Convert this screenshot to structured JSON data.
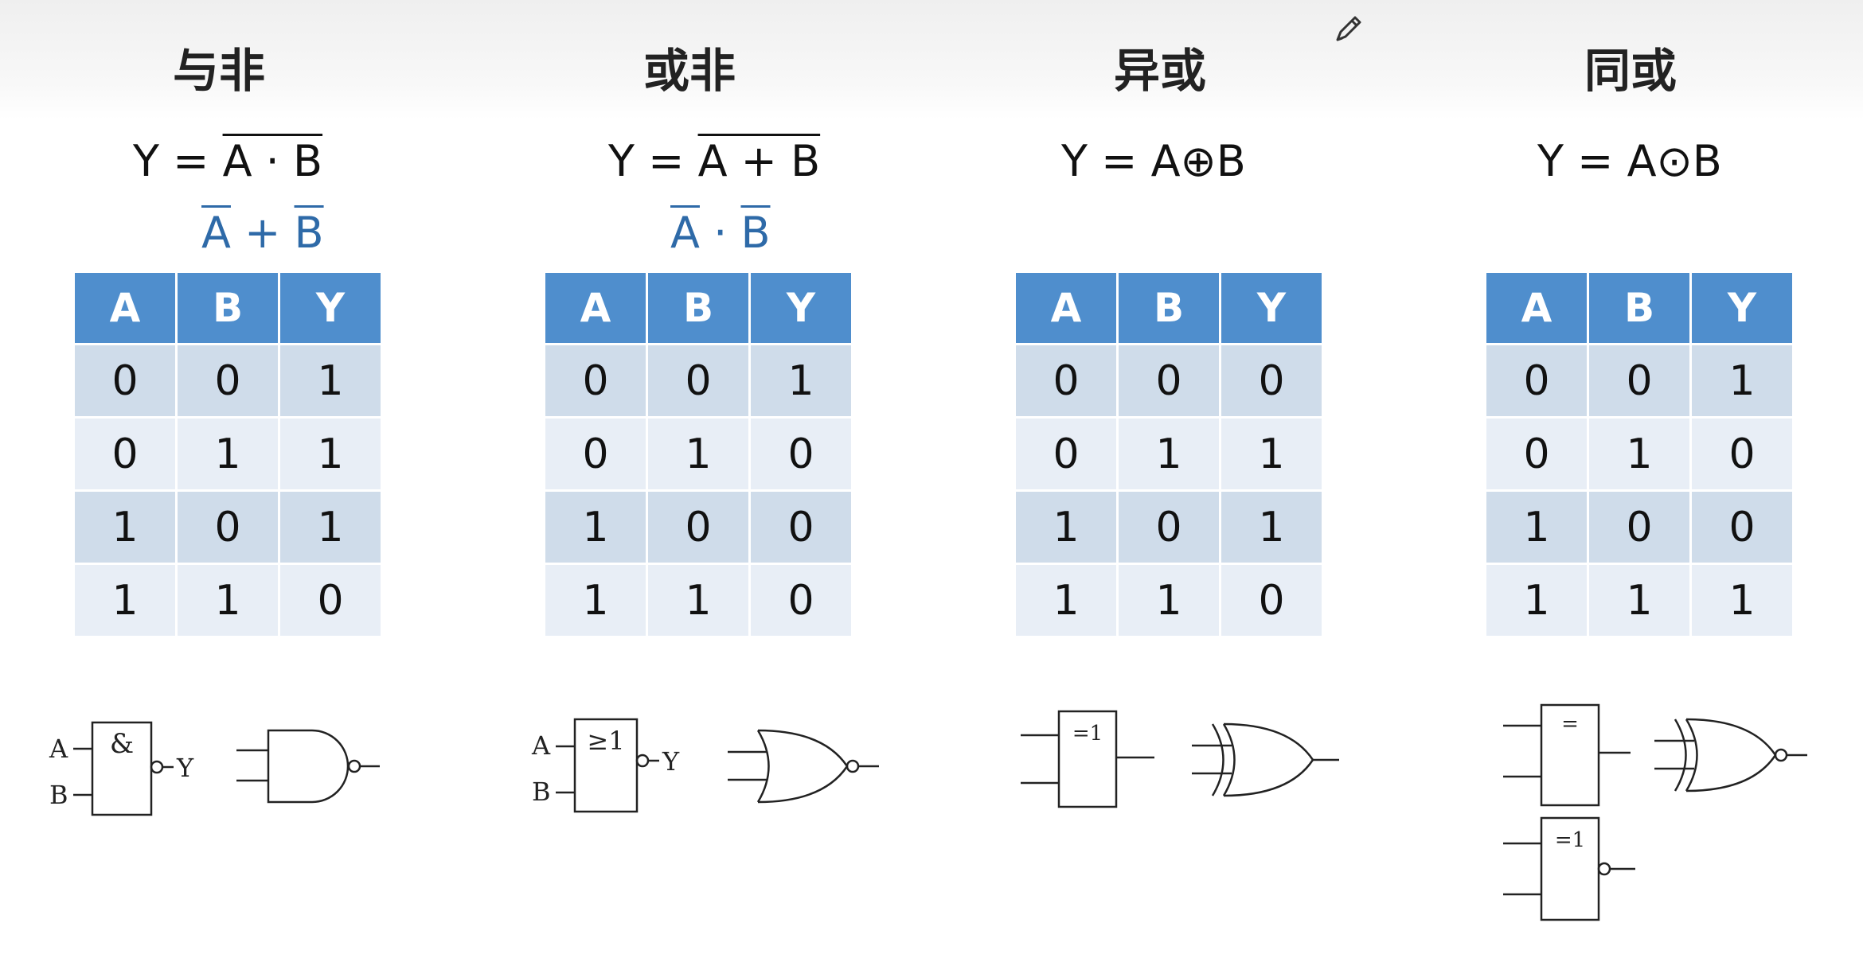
{
  "gates": [
    {
      "title": "与非",
      "formula": {
        "prefix": "Y = ",
        "expr": "A · B"
      },
      "alt": {
        "a": "A",
        "op": " + ",
        "b": "B"
      },
      "headers": [
        "A",
        "B",
        "Y"
      ],
      "rows": [
        [
          "0",
          "0",
          "1"
        ],
        [
          "0",
          "1",
          "1"
        ],
        [
          "1",
          "0",
          "1"
        ],
        [
          "1",
          "1",
          "0"
        ]
      ],
      "symbol": {
        "label": "&",
        "input_a": "A",
        "input_b": "B",
        "output": "Y"
      }
    },
    {
      "title": "或非",
      "formula": {
        "prefix": "Y = ",
        "expr": "A + B"
      },
      "alt": {
        "a": "A",
        "op": " · ",
        "b": "B"
      },
      "headers": [
        "A",
        "B",
        "Y"
      ],
      "rows": [
        [
          "0",
          "0",
          "1"
        ],
        [
          "0",
          "1",
          "0"
        ],
        [
          "1",
          "0",
          "0"
        ],
        [
          "1",
          "1",
          "0"
        ]
      ],
      "symbol": {
        "label": "≥1",
        "input_a": "A",
        "input_b": "B",
        "output": "Y"
      }
    },
    {
      "title": "异或",
      "formula": {
        "prefix": "Y = ",
        "expr": "A⊕B"
      },
      "headers": [
        "A",
        "B",
        "Y"
      ],
      "rows": [
        [
          "0",
          "0",
          "0"
        ],
        [
          "0",
          "1",
          "1"
        ],
        [
          "1",
          "0",
          "1"
        ],
        [
          "1",
          "1",
          "0"
        ]
      ],
      "symbol": {
        "label": "=1"
      }
    },
    {
      "title": "同或",
      "formula": {
        "prefix": "Y = ",
        "expr": "A⊙B"
      },
      "headers": [
        "A",
        "B",
        "Y"
      ],
      "rows": [
        [
          "0",
          "0",
          "1"
        ],
        [
          "0",
          "1",
          "0"
        ],
        [
          "1",
          "0",
          "0"
        ],
        [
          "1",
          "1",
          "1"
        ]
      ],
      "symbol": {
        "label": "=",
        "label2": "=1"
      }
    }
  ]
}
